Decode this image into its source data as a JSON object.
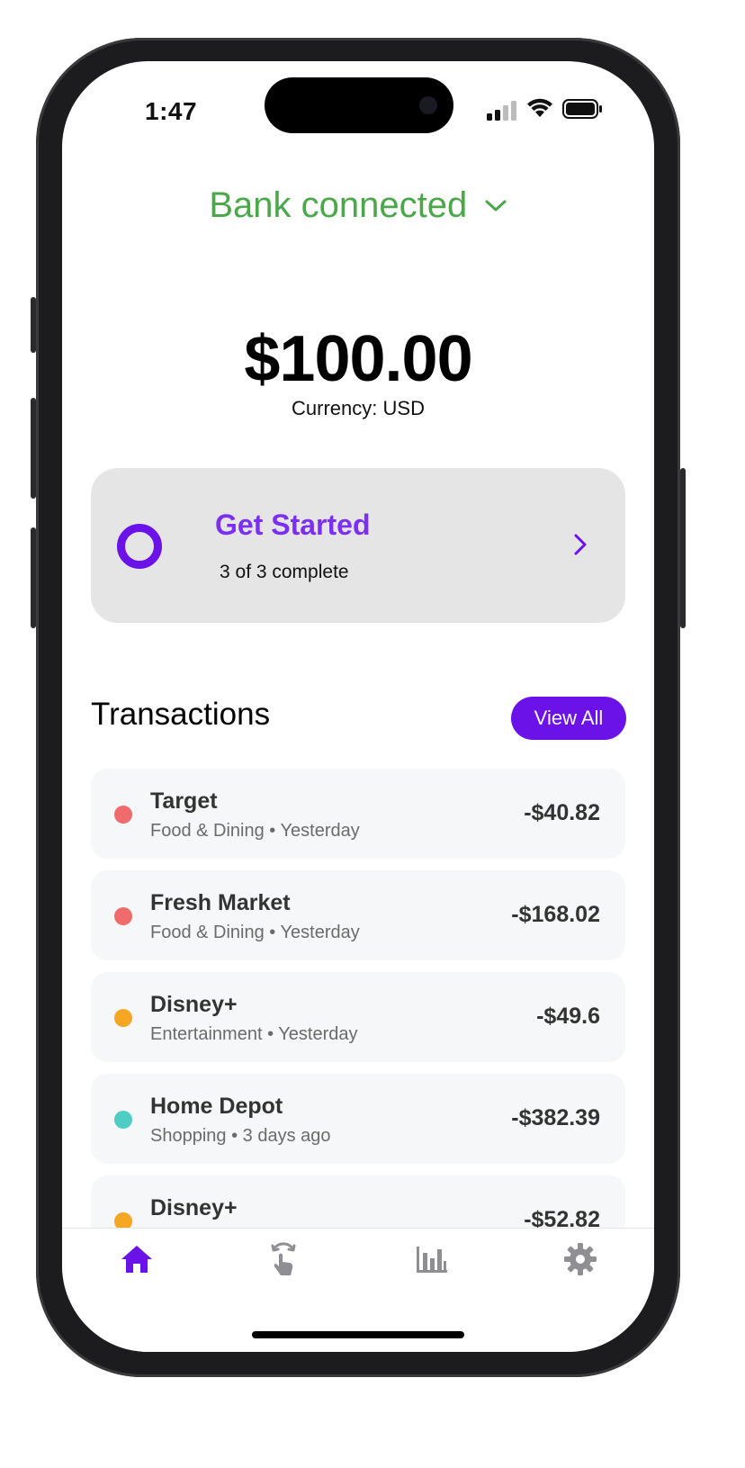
{
  "status_bar": {
    "time": "1:47"
  },
  "header": {
    "bank_status": "Bank connected",
    "bank_status_color": "#4aa84a"
  },
  "balance": {
    "amount": "$100.00",
    "currency_label": "Currency: USD"
  },
  "get_started": {
    "title": "Get Started",
    "progress": "3 of 3 complete",
    "accent_color": "#6a12e8"
  },
  "transactions": {
    "title": "Transactions",
    "view_all_label": "View All",
    "items": [
      {
        "name": "Target",
        "category": "Food & Dining",
        "when": "Yesterday",
        "amount": "-$40.82",
        "dot_color": "#f06b6b"
      },
      {
        "name": "Fresh Market",
        "category": "Food & Dining",
        "when": "Yesterday",
        "amount": "-$168.02",
        "dot_color": "#f06b6b"
      },
      {
        "name": "Disney+",
        "category": "Entertainment",
        "when": "Yesterday",
        "amount": "-$49.6",
        "dot_color": "#f5a623"
      },
      {
        "name": "Home Depot",
        "category": "Shopping",
        "when": "3 days ago",
        "amount": "-$382.39",
        "dot_color": "#4ecdc4"
      },
      {
        "name": "Disney+",
        "category": "",
        "when": "",
        "amount": "-$52.82",
        "dot_color": "#f5a623"
      }
    ]
  },
  "tab_bar": {
    "tabs": [
      {
        "icon": "home-icon",
        "active": true
      },
      {
        "icon": "tap-gesture-icon",
        "active": false
      },
      {
        "icon": "bar-chart-icon",
        "active": false
      },
      {
        "icon": "gear-icon",
        "active": false
      }
    ],
    "active_color": "#6a12e8",
    "inactive_color": "#8e8e93"
  }
}
